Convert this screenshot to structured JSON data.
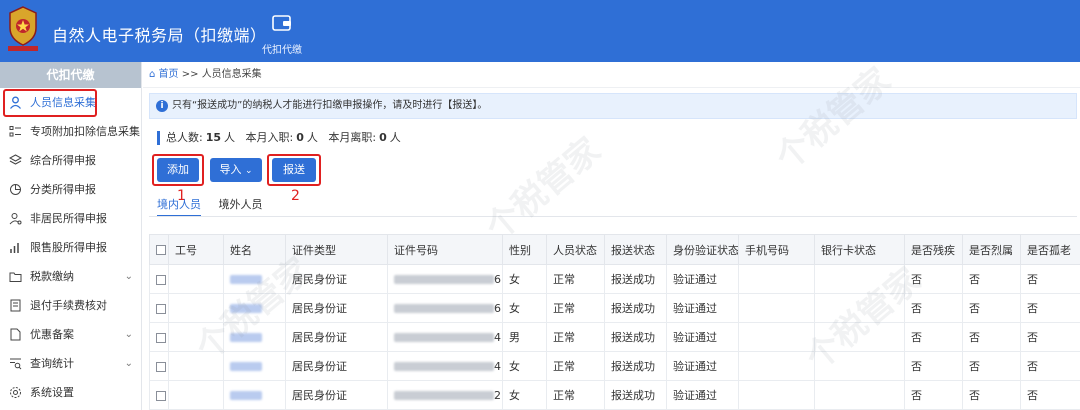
{
  "header": {
    "title": "自然人电子税务局（扣缴端）",
    "nav_item": "代扣代缴"
  },
  "sidebar": {
    "section": "代扣代缴",
    "items": [
      {
        "label": "人员信息采集",
        "icon": "person-icon",
        "active": true,
        "expandable": false
      },
      {
        "label": "专项附加扣除信息采集",
        "icon": "list-icon",
        "active": false,
        "expandable": false
      },
      {
        "label": "综合所得申报",
        "icon": "layers-icon",
        "active": false,
        "expandable": false
      },
      {
        "label": "分类所得申报",
        "icon": "pie-icon",
        "active": false,
        "expandable": false
      },
      {
        "label": "非居民所得申报",
        "icon": "user-cog-icon",
        "active": false,
        "expandable": false
      },
      {
        "label": "限售股所得申报",
        "icon": "bar-chart-icon",
        "active": false,
        "expandable": false
      },
      {
        "label": "税款缴纳",
        "icon": "folder-icon",
        "active": false,
        "expandable": true
      },
      {
        "label": "退付手续费核对",
        "icon": "doc-check-icon",
        "active": false,
        "expandable": false
      },
      {
        "label": "优惠备案",
        "icon": "doc-icon",
        "active": false,
        "expandable": true
      },
      {
        "label": "查询统计",
        "icon": "search-list-icon",
        "active": false,
        "expandable": true
      },
      {
        "label": "系统设置",
        "icon": "gear-icon",
        "active": false,
        "expandable": false
      }
    ]
  },
  "breadcrumb": {
    "home": "首页",
    "sep": ">>",
    "current": "人员信息采集"
  },
  "notice": "只有“报送成功”的纳税人才能进行扣缴申报操作，请及时进行【报送】。",
  "stats": {
    "total_label": "总人数:",
    "total": "15",
    "total_unit": "人",
    "hired_label": "本月入职:",
    "hired": "0",
    "hired_unit": "人",
    "left_label": "本月离职:",
    "left": "0",
    "left_unit": "人"
  },
  "toolbar": {
    "add": "添加",
    "import": "导入",
    "submit": "报送"
  },
  "annotations": {
    "one": "1",
    "two": "2"
  },
  "tabs": [
    "境内人员",
    "境外人员"
  ],
  "table": {
    "columns": [
      "",
      "工号",
      "姓名",
      "证件类型",
      "证件号码",
      "性别",
      "人员状态",
      "报送状态",
      "身份验证状态",
      "手机号码",
      "银行卡状态",
      "是否残疾",
      "是否烈属",
      "是否孤老"
    ],
    "rows": [
      {
        "id_type": "居民身份证",
        "id_tail": "6",
        "gender": "女",
        "status": "正常",
        "submit": "报送成功",
        "verify": "验证通过",
        "disabled": "否",
        "martyr": "否",
        "elderly": "否"
      },
      {
        "id_type": "居民身份证",
        "id_tail": "6",
        "gender": "女",
        "status": "正常",
        "submit": "报送成功",
        "verify": "验证通过",
        "disabled": "否",
        "martyr": "否",
        "elderly": "否"
      },
      {
        "id_type": "居民身份证",
        "id_tail": "4",
        "gender": "男",
        "status": "正常",
        "submit": "报送成功",
        "verify": "验证通过",
        "disabled": "否",
        "martyr": "否",
        "elderly": "否"
      },
      {
        "id_type": "居民身份证",
        "id_tail": "4",
        "gender": "女",
        "status": "正常",
        "submit": "报送成功",
        "verify": "验证通过",
        "disabled": "否",
        "martyr": "否",
        "elderly": "否"
      },
      {
        "id_type": "居民身份证",
        "id_tail": "2",
        "gender": "女",
        "status": "正常",
        "submit": "报送成功",
        "verify": "验证通过",
        "disabled": "否",
        "martyr": "否",
        "elderly": "否"
      }
    ]
  },
  "watermark": "个税管家",
  "colors": {
    "brand": "#2f6fd6",
    "highlight": "#e02020"
  }
}
